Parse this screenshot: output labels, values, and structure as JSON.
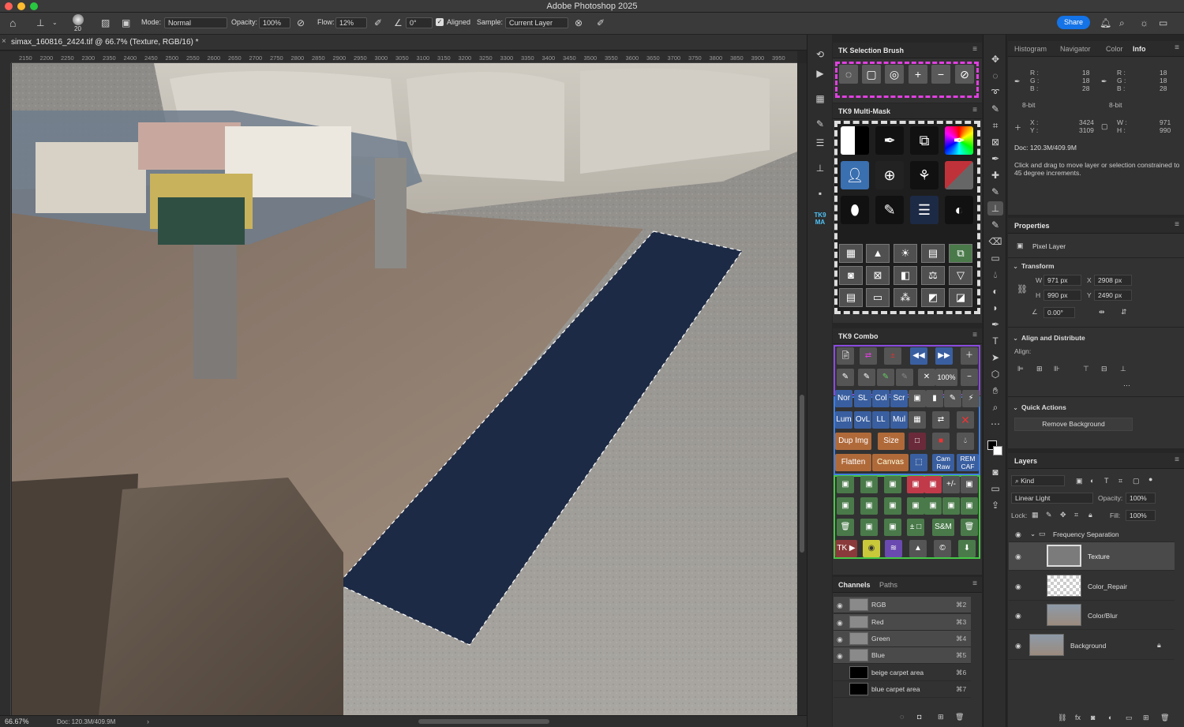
{
  "app": {
    "title": "Adobe Photoshop 2025"
  },
  "options": {
    "brush_size": "20",
    "mode_label": "Mode:",
    "mode_value": "Normal",
    "opacity_label": "Opacity:",
    "opacity_value": "100%",
    "flow_label": "Flow:",
    "flow_value": "12%",
    "angle_value": "0°",
    "aligned_label": "Aligned",
    "sample_label": "Sample:",
    "sample_value": "Current Layer",
    "share_label": "Share"
  },
  "document": {
    "tab_label": "simax_160816_2424.tif @ 66.7% (Texture, RGB/16) *"
  },
  "ruler": {
    "ticks": [
      "2150",
      "2200",
      "2250",
      "2300",
      "2350",
      "2400",
      "2450",
      "2500",
      "2550",
      "2600",
      "2650",
      "2700",
      "2750",
      "2800",
      "2850",
      "2900",
      "2950",
      "3000",
      "3050",
      "3100",
      "3150",
      "3200",
      "3250",
      "3300",
      "3350",
      "3400",
      "3450",
      "3500",
      "3550",
      "3600",
      "3650",
      "3700",
      "3750",
      "3800",
      "3850",
      "3900",
      "3950"
    ]
  },
  "status": {
    "zoom": "66.67%",
    "doc": "Doc: 120.3M/409.9M"
  },
  "selection_brush": {
    "title": "TK Selection Brush",
    "buttons": [
      "lasso-circle",
      "rect-select",
      "ellipse-select",
      "+",
      "−",
      "⊘"
    ]
  },
  "multimask": {
    "title": "TK9 Multi-Mask"
  },
  "combo": {
    "title": "TK9 Combo",
    "rows": [
      [
        "📄",
        "⇄",
        "+/-",
        "◀◀",
        "▶▶",
        "+"
      ],
      [
        "✎",
        "✎",
        "✎",
        "✎",
        "✕",
        "100%",
        "−"
      ],
      [
        "Nor",
        "SL",
        "Col",
        "Scr",
        "▣",
        "▮",
        "✎",
        "⚡"
      ],
      [
        "Lum",
        "OvL",
        "LL",
        "Mul",
        "▦",
        "⇄",
        "X"
      ],
      [
        "Dup Img",
        "Size",
        "□",
        "■",
        "💧"
      ],
      [
        "Flatten",
        "Canvas",
        "⬚",
        "Cam Raw",
        "REM CAF"
      ],
      [
        "▣",
        "▣",
        "▣",
        "▣",
        "▣",
        "+/-",
        "▣"
      ],
      [
        "▣",
        "▣",
        "▣",
        "▣",
        "▣",
        "▣",
        "▣"
      ],
      [
        "🗑",
        "▣",
        "▣",
        "± □",
        "S&M",
        "🗑"
      ],
      [
        "TK ▶",
        "◉",
        "≋",
        "▲",
        "©",
        "⬇"
      ]
    ]
  },
  "channels": {
    "tabs": [
      "Channels",
      "Paths"
    ],
    "rows": [
      {
        "name": "RGB",
        "key": "⌘2"
      },
      {
        "name": "Red",
        "key": "⌘3"
      },
      {
        "name": "Green",
        "key": "⌘4"
      },
      {
        "name": "Blue",
        "key": "⌘5"
      },
      {
        "name": "beige carpet area",
        "key": "⌘6"
      },
      {
        "name": "blue carpet area",
        "key": "⌘7"
      }
    ]
  },
  "info": {
    "tabs": [
      "Histogram",
      "Navigator",
      "Color",
      "Info"
    ],
    "r1": "18",
    "g1": "18",
    "b1": "28",
    "r2": "18",
    "g2": "18",
    "b2": "28",
    "bit1": "8-bit",
    "bit2": "8-bit",
    "x": "3424",
    "y": "3109",
    "w": "971",
    "h": "990",
    "doc": "Doc: 120.3M/409.9M",
    "hint": "Click and drag to move layer or selection constrained to 45 degree increments."
  },
  "properties": {
    "title": "Properties",
    "kind": "Pixel Layer",
    "transform_label": "Transform",
    "w": "971 px",
    "x": "2908 px",
    "h": "990 px",
    "y": "2490 px",
    "angle": "0.00°",
    "align_label": "Align and Distribute",
    "align_sub": "Align:",
    "quick_actions": "Quick Actions",
    "remove_bg": "Remove Background"
  },
  "layers": {
    "title": "Layers",
    "kind": "Kind",
    "blend": "Linear Light",
    "opacity_label": "Opacity:",
    "opacity": "100%",
    "lock_label": "Lock:",
    "fill_label": "Fill:",
    "fill": "100%",
    "items": [
      {
        "name": "Frequency Separation"
      },
      {
        "name": "Texture"
      },
      {
        "name": "Color_Repair"
      },
      {
        "name": "Color/Blur"
      },
      {
        "name": "Background"
      }
    ]
  }
}
